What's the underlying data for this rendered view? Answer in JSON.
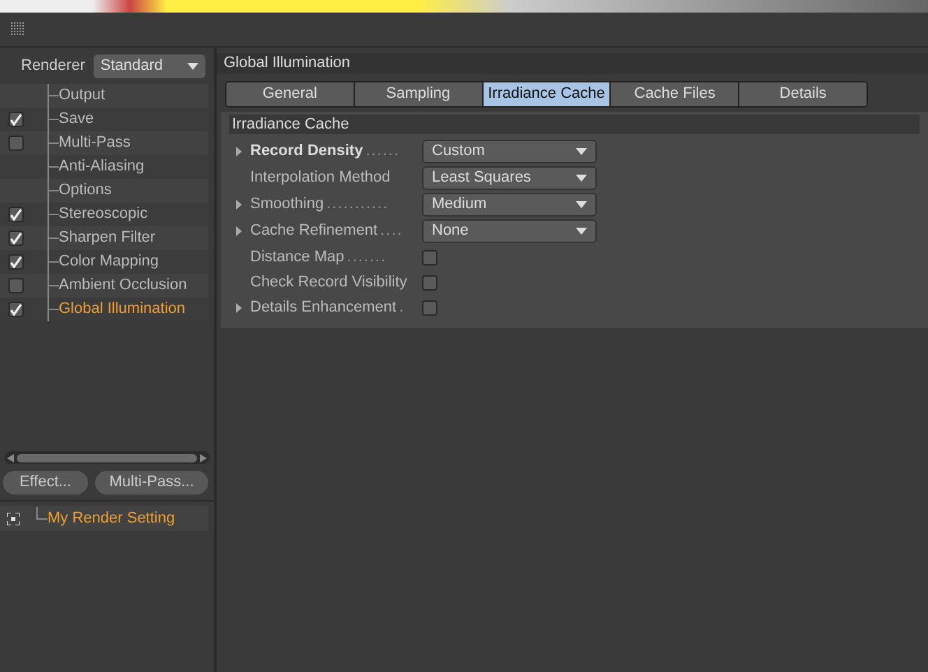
{
  "renderer": {
    "label": "Renderer",
    "value": "Standard"
  },
  "tree": [
    {
      "label": "Output",
      "kind": "plain",
      "selected": false
    },
    {
      "label": "Save",
      "kind": "toggle",
      "checked": true,
      "selected": false
    },
    {
      "label": "Multi-Pass",
      "kind": "toggle",
      "checked": false,
      "selected": false
    },
    {
      "label": "Anti-Aliasing",
      "kind": "plain",
      "selected": false
    },
    {
      "label": "Options",
      "kind": "plain",
      "selected": false
    },
    {
      "label": "Stereoscopic",
      "kind": "toggle",
      "checked": true,
      "selected": false
    },
    {
      "label": "Sharpen Filter",
      "kind": "toggle",
      "checked": true,
      "selected": false
    },
    {
      "label": "Color Mapping",
      "kind": "toggle",
      "checked": true,
      "selected": false
    },
    {
      "label": "Ambient Occlusion",
      "kind": "toggle",
      "checked": false,
      "selected": false
    },
    {
      "label": "Global Illumination",
      "kind": "toggle",
      "checked": true,
      "selected": true
    }
  ],
  "buttons": [
    "Effect...",
    "Multi-Pass..."
  ],
  "settings": [
    {
      "label": "My Render Setting",
      "selected": true
    }
  ],
  "panel": {
    "title": "Global Illumination",
    "tabs": [
      {
        "label": "General",
        "selected": false
      },
      {
        "label": "Sampling",
        "selected": false
      },
      {
        "label": "Irradiance Cache",
        "selected": true
      },
      {
        "label": "Cache Files",
        "selected": false
      },
      {
        "label": "Details",
        "selected": false
      }
    ],
    "section": "Irradiance Cache",
    "rows": [
      {
        "label": "Record Density",
        "dots": "......",
        "kind": "dropdown",
        "value": "Custom",
        "expandable": true,
        "bold": true
      },
      {
        "label": "Interpolation Method",
        "kind": "dropdown",
        "value": "Least Squares",
        "expandable": false,
        "bold": false
      },
      {
        "label": "Smoothing",
        "dots": "...........",
        "kind": "dropdown",
        "value": "Medium",
        "expandable": true,
        "bold": false
      },
      {
        "label": "Cache Refinement",
        "dots": "....",
        "kind": "dropdown",
        "value": "None",
        "expandable": true,
        "bold": false
      },
      {
        "label": "Distance Map",
        "dots": ".......",
        "kind": "checkbox",
        "checked": false,
        "expandable": false,
        "bold": false
      },
      {
        "label": "Check Record Visibility",
        "kind": "checkbox",
        "checked": false,
        "expandable": false,
        "bold": false
      },
      {
        "label": "Details Enhancement",
        "dots": ".",
        "kind": "checkbox",
        "checked": false,
        "expandable": true,
        "bold": false
      }
    ]
  }
}
